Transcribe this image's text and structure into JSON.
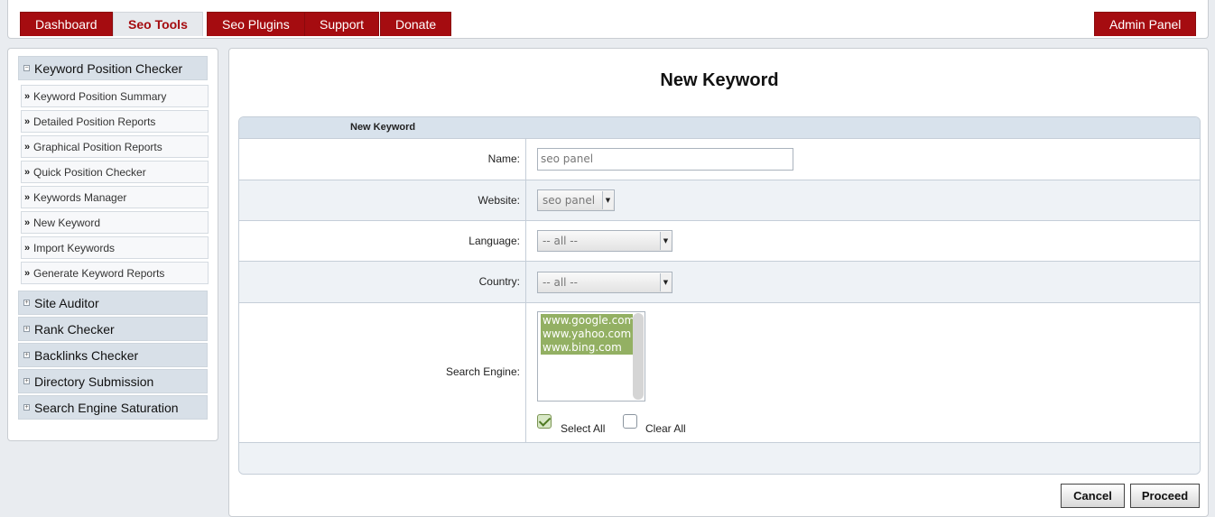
{
  "nav": {
    "tabs": [
      {
        "label": "Dashboard"
      },
      {
        "label": "Seo Tools"
      },
      {
        "label": "Seo Plugins"
      },
      {
        "label": "Support"
      },
      {
        "label": "Donate"
      }
    ],
    "admin": "Admin Panel",
    "active_tab": "Seo Tools"
  },
  "sidebar": {
    "open_section": {
      "title": "Keyword Position Checker",
      "items": [
        {
          "label": "Keyword Position Summary"
        },
        {
          "label": "Detailed Position Reports"
        },
        {
          "label": "Graphical Position Reports"
        },
        {
          "label": "Quick Position Checker"
        },
        {
          "label": "Keywords Manager"
        },
        {
          "label": "New Keyword"
        },
        {
          "label": "Import Keywords"
        },
        {
          "label": "Generate Keyword Reports"
        }
      ]
    },
    "sections": [
      {
        "title": "Site Auditor"
      },
      {
        "title": "Rank Checker"
      },
      {
        "title": "Backlinks Checker"
      },
      {
        "title": "Directory Submission"
      },
      {
        "title": "Search Engine Saturation"
      }
    ]
  },
  "main": {
    "title": "New Keyword",
    "form_title": "New Keyword",
    "fields": {
      "name_label": "Name:",
      "name_value": "seo panel",
      "website_label": "Website:",
      "website_value": "seo panel",
      "language_label": "Language:",
      "language_value": "-- all --",
      "country_label": "Country:",
      "country_value": "-- all --",
      "engine_label": "Search Engine:",
      "engines": [
        "www.google.com",
        "www.yahoo.com",
        "www.bing.com"
      ],
      "select_all": "Select All",
      "clear_all": "Clear All"
    },
    "buttons": {
      "cancel": "Cancel",
      "proceed": "Proceed"
    }
  },
  "colors": {
    "nav_red": "#a50c10",
    "selected_option": "#93b063",
    "header_blue": "#d8e2ec"
  }
}
